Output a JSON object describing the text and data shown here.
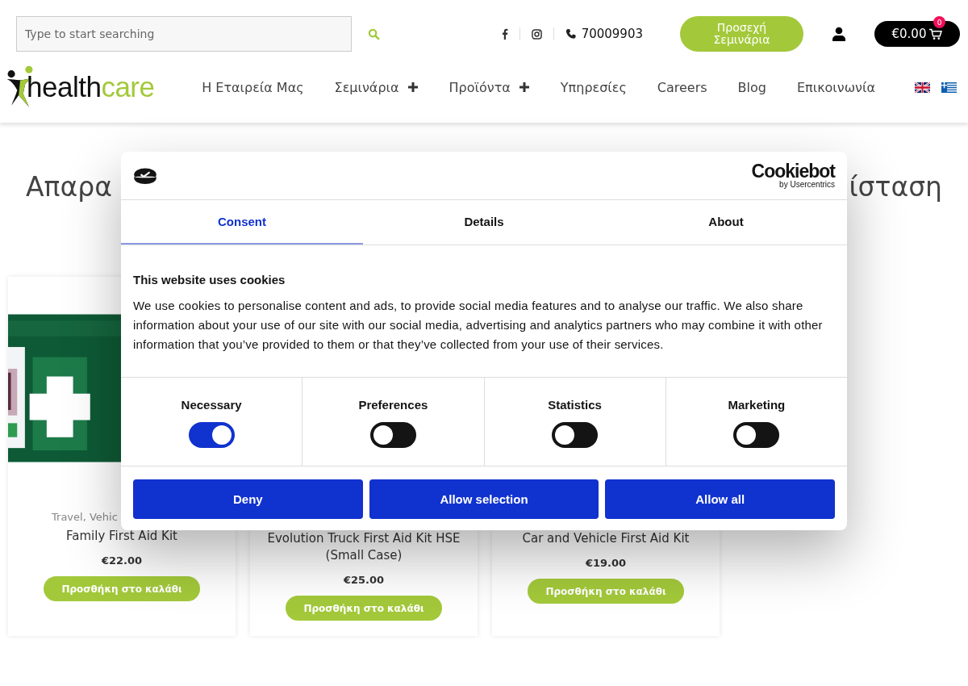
{
  "header": {
    "search": {
      "placeholder": "Type to start searching"
    },
    "phone": "70009903",
    "seminars_button": "Προσεχή Σεμινάρια",
    "cart": {
      "total": "€0.00",
      "count": "0"
    }
  },
  "logo": {
    "text_dark": "health",
    "text_green": "care"
  },
  "nav": [
    {
      "label": "Η Εταιρεία Μας",
      "has_submenu": false
    },
    {
      "label": "Σεμινάρια",
      "has_submenu": true
    },
    {
      "label": "Προϊόντα",
      "has_submenu": true
    },
    {
      "label": "Υπηρεσίες",
      "has_submenu": false
    },
    {
      "label": "Careers",
      "has_submenu": false
    },
    {
      "label": "Blog",
      "has_submenu": false
    },
    {
      "label": "Επικοινωνία",
      "has_submenu": false
    }
  ],
  "page": {
    "heading_start": "Απαρα",
    "heading_end": "ίσταση"
  },
  "products": [
    {
      "category": "Travel, Vehic",
      "title": "Family First Aid Kit",
      "price": "€22.00",
      "button": "Προσθήκη στο καλάθι"
    },
    {
      "title": "Evolution Truck First Aid Kit HSE (Small Case)",
      "price": "€25.00",
      "button": "Προσθήκη στο καλάθι"
    },
    {
      "title": "Car and Vehicle First Aid Kit",
      "price": "€19.00",
      "button": "Προσθήκη στο καλάθι"
    }
  ],
  "cookie_dialog": {
    "brand": "Cookiebot",
    "brand_sub": "by Usercentrics",
    "tabs": [
      {
        "label": "Consent",
        "selected": true
      },
      {
        "label": "Details",
        "selected": false
      },
      {
        "label": "About",
        "selected": false
      }
    ],
    "title": "This website uses cookies",
    "text": "We use cookies to personalise content and ads, to provide social media features and to analyse our traffic. We also share information about your use of our site with our social media, advertising and analytics partners who may combine it with other information that you’ve provided to them or that they’ve collected from your use of their services.",
    "categories": [
      {
        "label": "Necessary",
        "on": true
      },
      {
        "label": "Preferences",
        "on": false
      },
      {
        "label": "Statistics",
        "on": false
      },
      {
        "label": "Marketing",
        "on": false
      }
    ],
    "buttons": [
      "Deny",
      "Allow selection",
      "Allow all"
    ]
  }
}
